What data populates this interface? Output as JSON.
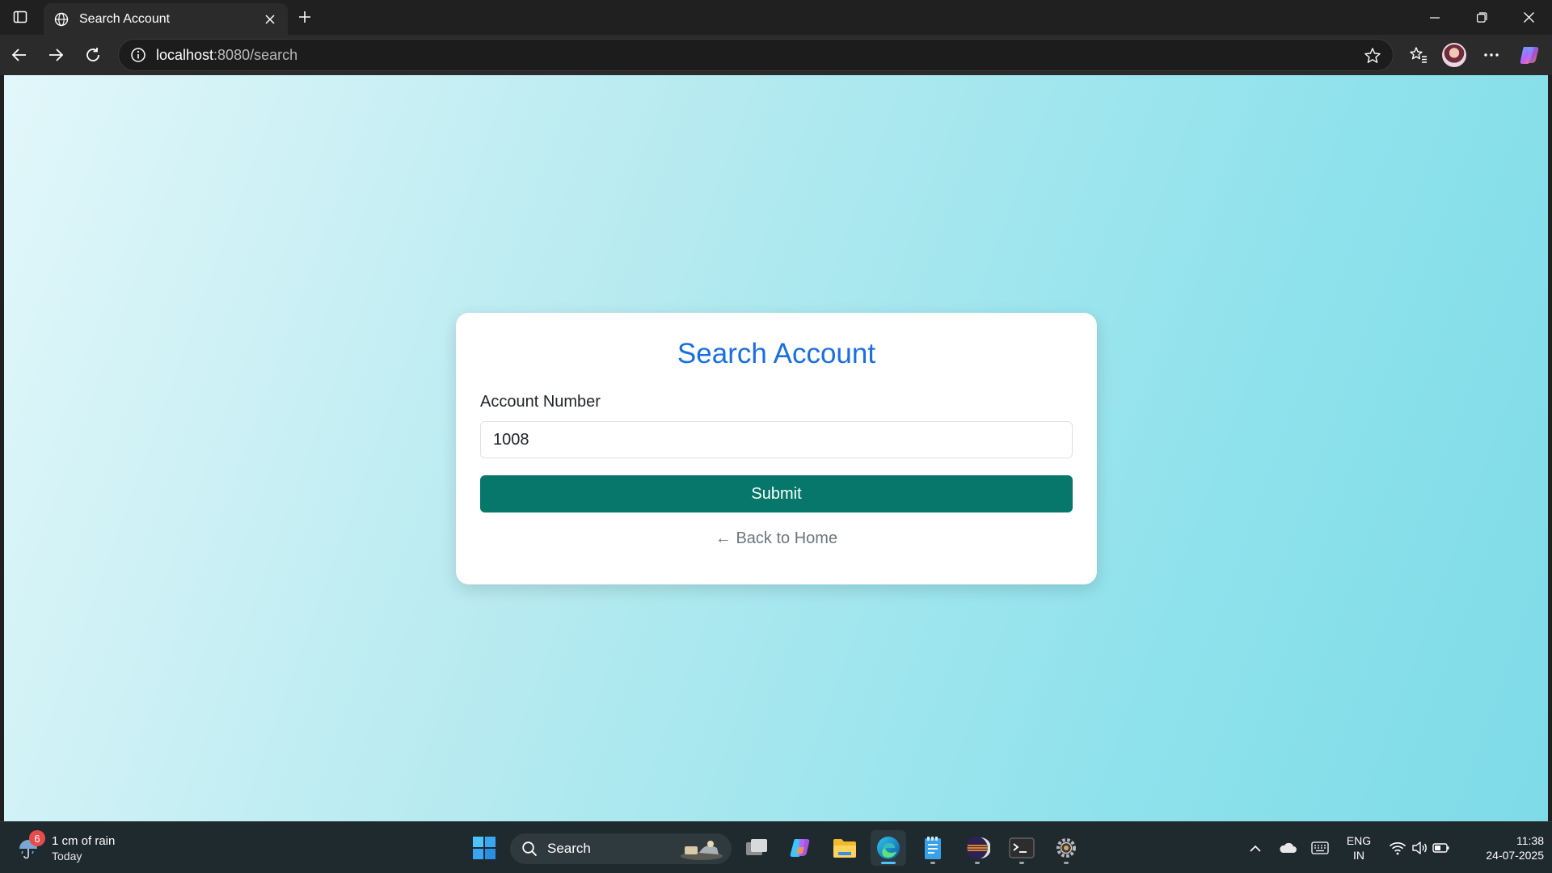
{
  "browser": {
    "tab": {
      "title": "Search Account",
      "favicon": "globe-icon"
    },
    "url": {
      "host": "localhost",
      "rest": ":8080/search"
    }
  },
  "page": {
    "title": "Search Account",
    "field_label": "Account Number",
    "field_value": "1008",
    "submit_label": "Submit",
    "back_link": "← Back to Home"
  },
  "taskbar": {
    "weather": {
      "main": "1 cm of rain",
      "sub": "Today",
      "badge": "6"
    },
    "search_label": "Search",
    "lang": {
      "line1": "ENG",
      "line2": "IN"
    },
    "clock": {
      "time": "11:38",
      "date": "24-07-2025"
    }
  },
  "colors": {
    "title_blue": "#1a6fe0",
    "submit_green": "#06776a",
    "gradient_start": "#e2f7fa",
    "gradient_end": "#7ddbe7"
  }
}
